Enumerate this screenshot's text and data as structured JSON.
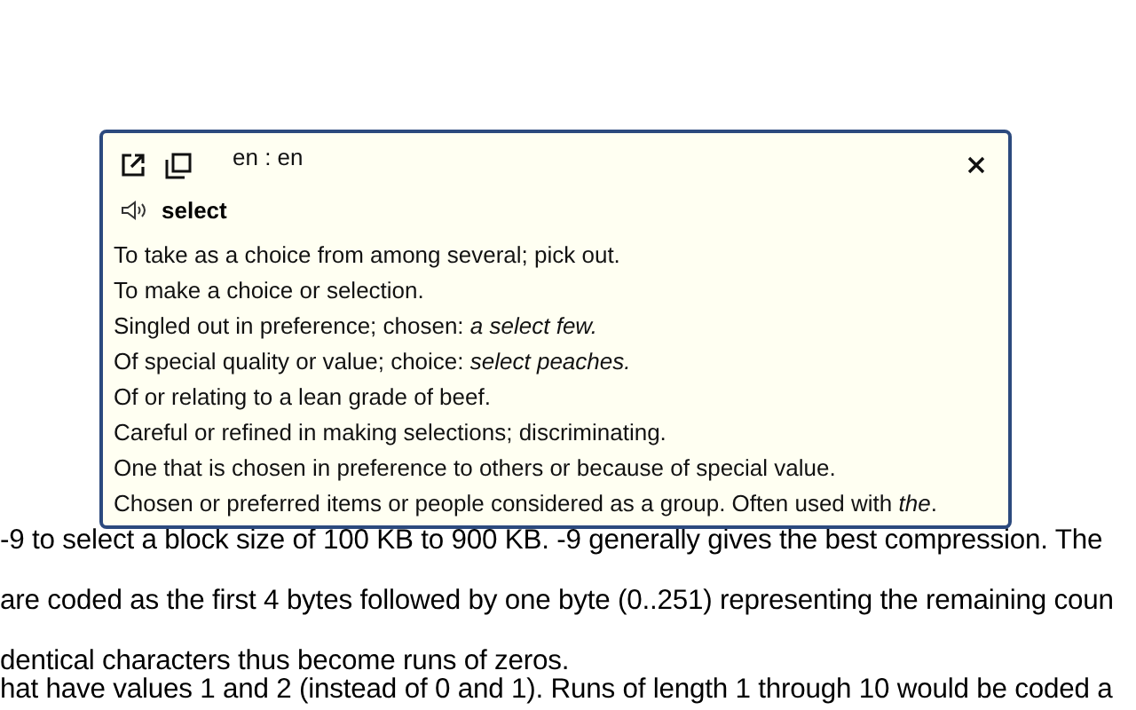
{
  "popup": {
    "languages": "en : en",
    "word": "select",
    "definitions": [
      "To take as a choice from among several; pick out.",
      "To make a choice or selection.",
      "Singled out in preference; chosen: *a select few.*",
      "Of special quality or value; choice: *select peaches.*",
      "Of or relating to a lean grade of beef.",
      "Careful or refined in making selections; discriminating.",
      "One that is chosen in preference to others or because of special value.",
      "Chosen or preferred items or people considered as a group. Often used with *the*."
    ]
  },
  "page_paragraphs": [
    [
      "-9 to select a block size of 100 KB to 900 KB. -9 generally gives the best compression. The"
    ],
    [
      "are coded as the first 4 bytes followed by one byte (0..251) representing the remaining coun"
    ],
    [
      "dentical characters thus become runs of zeros.",
      "hat have values 1 and 2 (instead of 0 and 1). Runs of length 1 through 10 would be coded a"
    ]
  ]
}
